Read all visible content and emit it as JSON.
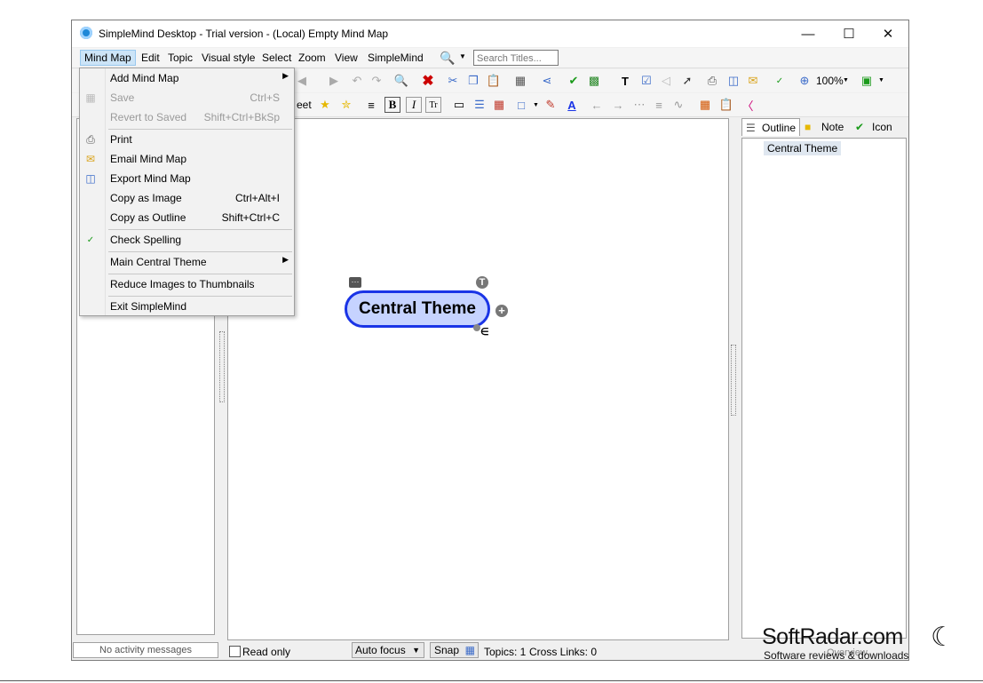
{
  "window": {
    "title": "SimpleMind Desktop - Trial version - (Local) Empty Mind Map",
    "minimize": "—",
    "maximize": "☐",
    "close": "✕"
  },
  "menubar": {
    "items": [
      "Mind Map",
      "Edit",
      "Topic",
      "Visual style",
      "Select",
      "Zoom",
      "View",
      "SimpleMind"
    ],
    "search_placeholder": "Search Titles..."
  },
  "toolbar": {
    "zoom_level": "100%",
    "stylesheet_partial": "eet"
  },
  "dropdown": {
    "items": [
      {
        "label": "Add Mind Map",
        "shortcut": "",
        "submenu": true,
        "disabled": false,
        "icon": ""
      },
      {
        "label": "Save",
        "shortcut": "Ctrl+S",
        "submenu": false,
        "disabled": true,
        "icon": "save-icon"
      },
      {
        "label": "Revert to Saved",
        "shortcut": "Shift+Ctrl+BkSp",
        "submenu": false,
        "disabled": true,
        "icon": ""
      },
      {
        "label": "Print",
        "shortcut": "",
        "submenu": false,
        "disabled": false,
        "icon": "printer-icon"
      },
      {
        "label": "Email Mind Map",
        "shortcut": "",
        "submenu": false,
        "disabled": false,
        "icon": "envelope-icon"
      },
      {
        "label": "Export Mind Map",
        "shortcut": "",
        "submenu": false,
        "disabled": false,
        "icon": "export-icon"
      },
      {
        "label": "Copy as Image",
        "shortcut": "Ctrl+Alt+I",
        "submenu": false,
        "disabled": false,
        "icon": ""
      },
      {
        "label": "Copy as Outline",
        "shortcut": "Shift+Ctrl+C",
        "submenu": false,
        "disabled": false,
        "icon": ""
      },
      {
        "label": "Check Spelling",
        "shortcut": "",
        "submenu": false,
        "disabled": false,
        "icon": "spellcheck-icon"
      },
      {
        "label": "Main Central Theme",
        "shortcut": "",
        "submenu": true,
        "disabled": false,
        "icon": ""
      },
      {
        "label": "Reduce Images to Thumbnails",
        "shortcut": "",
        "submenu": false,
        "disabled": false,
        "icon": ""
      },
      {
        "label": "Exit SimpleMind",
        "shortcut": "",
        "submenu": false,
        "disabled": false,
        "icon": ""
      }
    ]
  },
  "canvas": {
    "central_node": "Central Theme",
    "top_badge": "T",
    "add_badge": "+",
    "more_badge": "···"
  },
  "right_panel": {
    "tabs": [
      "Outline",
      "Note",
      "Icon"
    ],
    "outline_items": [
      "Central Theme"
    ]
  },
  "statusbar": {
    "activity": "No activity messages",
    "read_only": "Read only",
    "auto_focus": "Auto focus",
    "snap": "Snap",
    "topics": "Topics: 1",
    "cross_links": "Cross Links: 0",
    "overview": "Overview"
  },
  "watermark": {
    "brand": "SoftRadar.com",
    "tagline": "Software reviews & downloads"
  }
}
